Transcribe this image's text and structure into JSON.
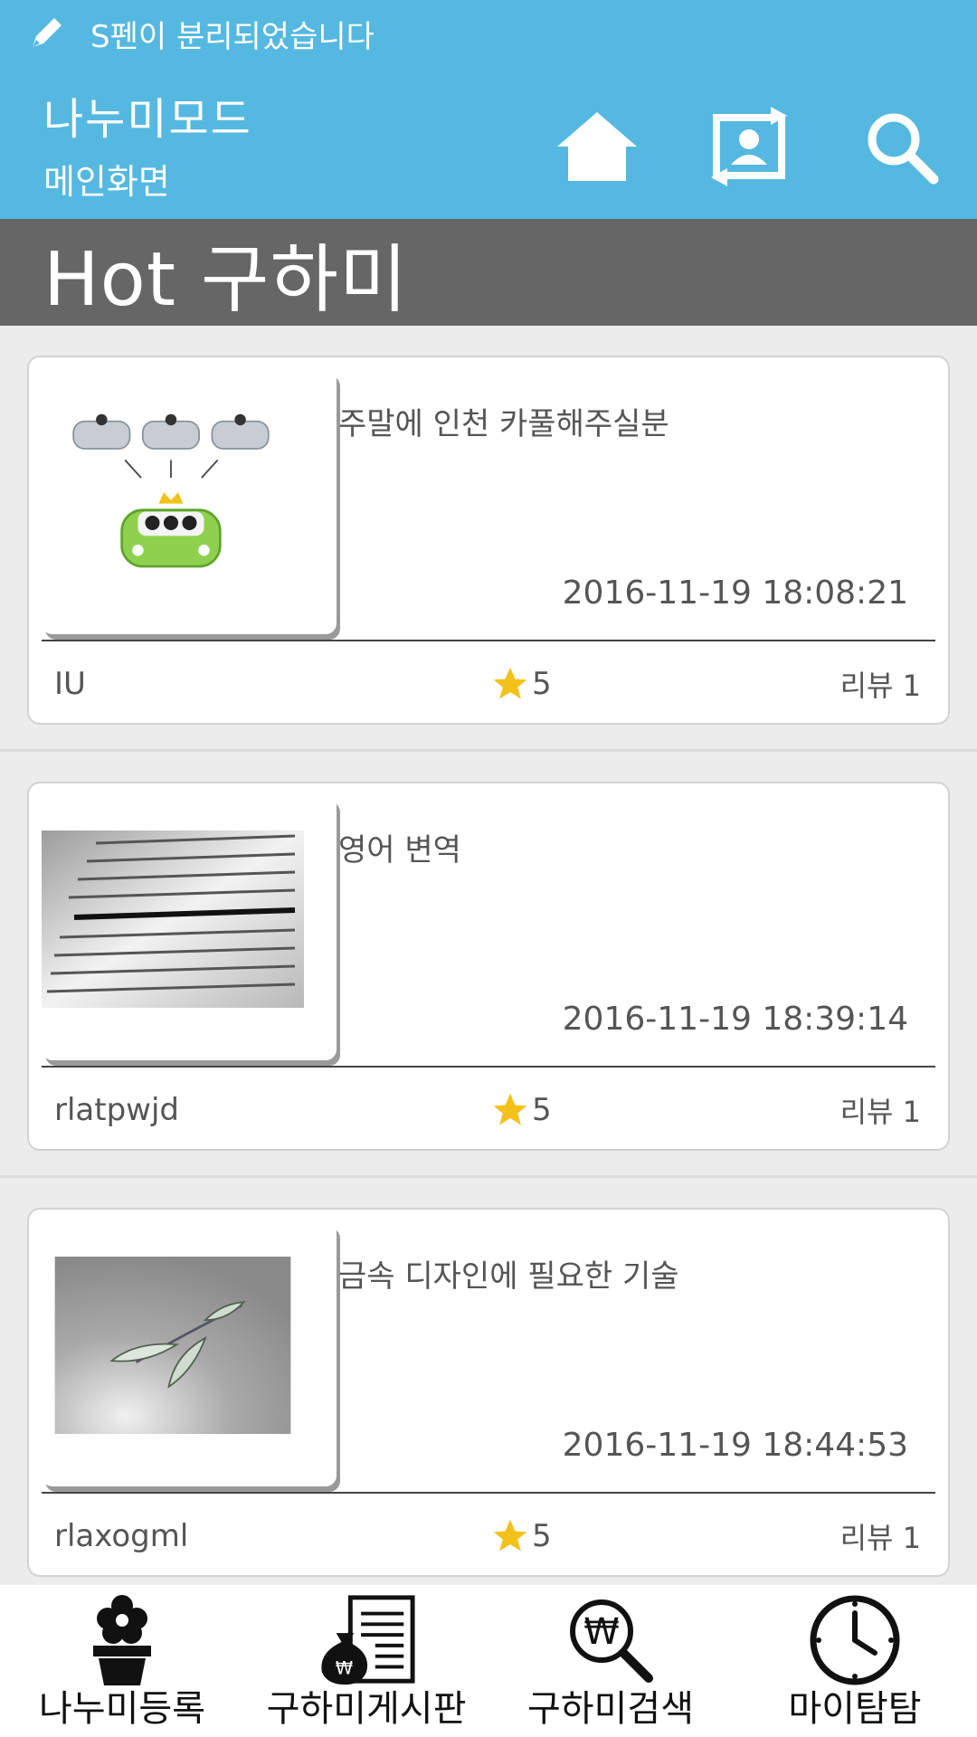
{
  "status_bar": {
    "message": "S펜이 분리되었습니다",
    "icon": "pen-icon"
  },
  "app_bar": {
    "title": "나누미모드",
    "subtitle": "메인화면",
    "actions": [
      {
        "icon": "home-icon"
      },
      {
        "icon": "switch-profile-icon"
      },
      {
        "icon": "search-icon"
      }
    ]
  },
  "section": {
    "title": "Hot 구하미"
  },
  "posts": [
    {
      "title": "주말에 인천 카풀해주실분",
      "date": "2016-11-19 18:08:21",
      "user": "IU",
      "rating": "5",
      "reviews": "리뷰 1",
      "image": "carpool-cars"
    },
    {
      "title": "영어 변역",
      "date": "2016-11-19 18:39:14",
      "user": "rlatpwjd",
      "rating": "5",
      "reviews": "리뷰 1",
      "image": "dictionary-translation"
    },
    {
      "title": "금속 디자인에 필요한 기술",
      "date": "2016-11-19 18:44:53",
      "user": "rlaxogml",
      "rating": "5",
      "reviews": "리뷰 1",
      "image": "metal-leaf-branch"
    }
  ],
  "bottom_nav": [
    {
      "label": "나누미등록",
      "icon": "flower-pot-icon"
    },
    {
      "label": "구하미게시판",
      "icon": "money-bag-board-icon"
    },
    {
      "label": "구하미검색",
      "icon": "won-search-icon"
    },
    {
      "label": "마이탐탐",
      "icon": "clock-icon"
    }
  ],
  "colors": {
    "app_bar": "#55b8e0",
    "section_header": "#666666",
    "star": "#f2c21b"
  }
}
